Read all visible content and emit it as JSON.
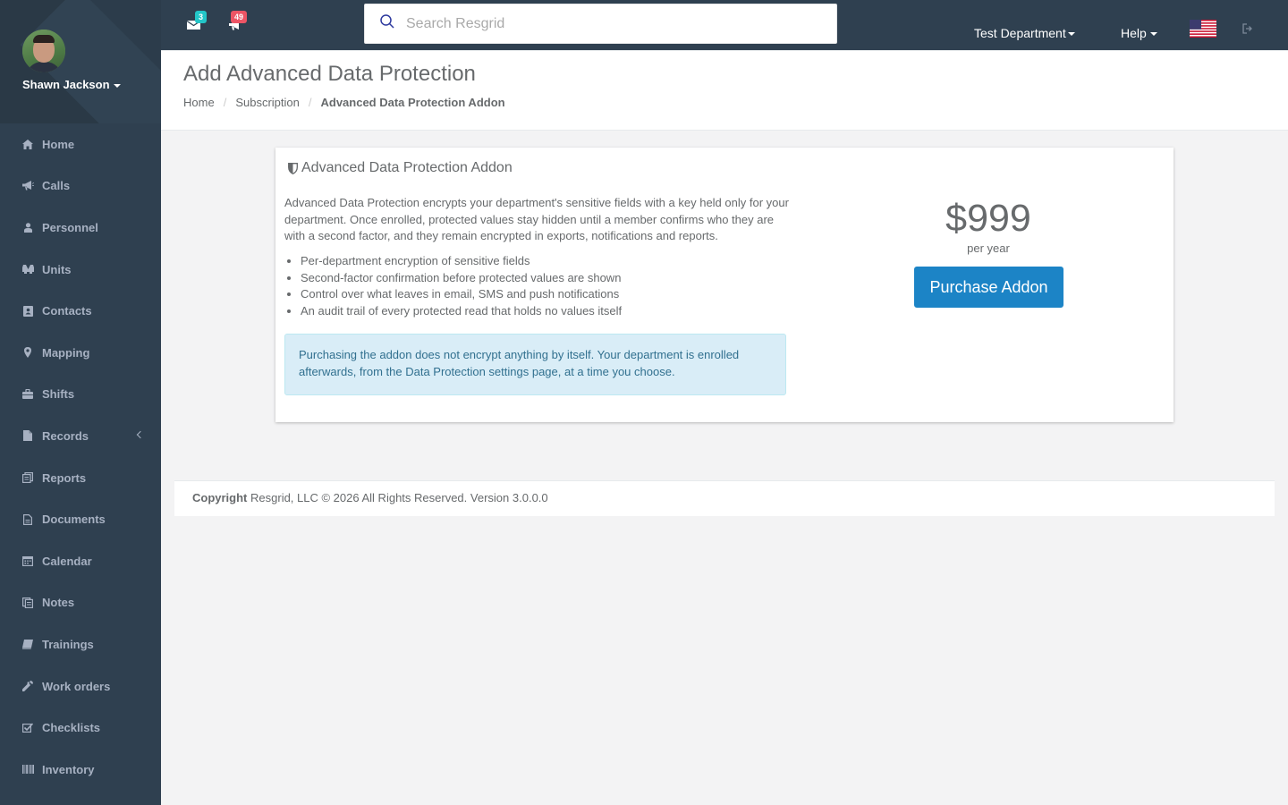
{
  "user": {
    "name": "Shawn Jackson"
  },
  "sidebar": {
    "items": [
      {
        "label": "Home",
        "icon": "home-icon"
      },
      {
        "label": "Calls",
        "icon": "bullhorn-icon"
      },
      {
        "label": "Personnel",
        "icon": "user-icon"
      },
      {
        "label": "Units",
        "icon": "truck-icon"
      },
      {
        "label": "Contacts",
        "icon": "address-book-icon"
      },
      {
        "label": "Mapping",
        "icon": "map-marker-icon"
      },
      {
        "label": "Shifts",
        "icon": "briefcase-icon"
      },
      {
        "label": "Records",
        "icon": "file-icon",
        "has_submenu": true
      },
      {
        "label": "Reports",
        "icon": "reports-icon"
      },
      {
        "label": "Documents",
        "icon": "document-icon"
      },
      {
        "label": "Calendar",
        "icon": "calendar-icon"
      },
      {
        "label": "Notes",
        "icon": "notes-icon"
      },
      {
        "label": "Trainings",
        "icon": "book-icon"
      },
      {
        "label": "Work orders",
        "icon": "wrench-icon"
      },
      {
        "label": "Checklists",
        "icon": "checklist-icon"
      },
      {
        "label": "Inventory",
        "icon": "barcode-icon"
      }
    ]
  },
  "topbar": {
    "messages_count": "3",
    "alerts_count": "49",
    "search_placeholder": "Search Resgrid",
    "department": "Test Department",
    "help": "Help"
  },
  "page": {
    "title": "Add Advanced Data Protection",
    "breadcrumb": [
      "Home",
      "Subscription",
      "Advanced Data Protection Addon"
    ]
  },
  "addon": {
    "title": "Advanced Data Protection Addon",
    "description": "Advanced Data Protection encrypts your department's sensitive fields with a key held only for your department. Once enrolled, protected values stay hidden until a member confirms who they are with a second factor, and they remain encrypted in exports, notifications and reports.",
    "features": [
      "Per-department encryption of sensitive fields",
      "Second-factor confirmation before protected values are shown",
      "Control over what leaves in email, SMS and push notifications",
      "An audit trail of every protected read that holds no values itself"
    ],
    "notice": "Purchasing the addon does not encrypt anything by itself. Your department is enrolled afterwards, from the Data Protection settings page, at a time you choose.",
    "price": "$999",
    "period": "per year",
    "button": "Purchase Addon"
  },
  "footer": {
    "copyright_label": "Copyright",
    "copyright_text": "Resgrid, LLC © 2026 All Rights Reserved.",
    "version": "Version 3.0.0.0"
  },
  "colors": {
    "sidebar": "#2f4050",
    "primary_button": "#1c84c6",
    "alert_bg": "#d9edf7"
  }
}
